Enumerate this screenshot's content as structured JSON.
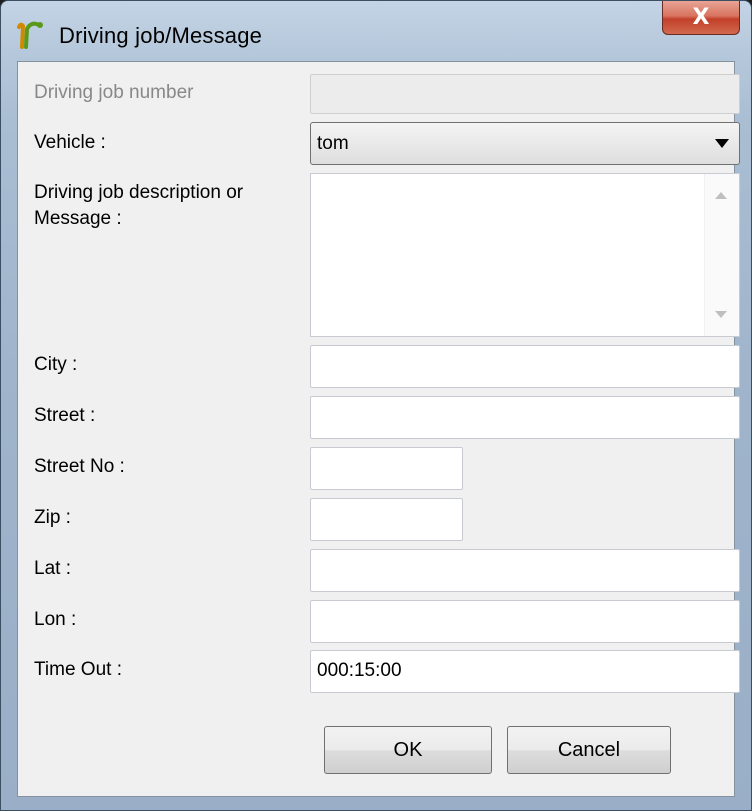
{
  "window": {
    "title": "Driving job/Message",
    "icon": "app-logo-icon",
    "close_label": "X"
  },
  "form": {
    "job_number": {
      "label": "Driving job number",
      "value": ""
    },
    "vehicle": {
      "label": "Vehicle :",
      "value": "tom"
    },
    "description": {
      "label_line1": "Driving job description or",
      "label_line2": "Message :",
      "value": ""
    },
    "city": {
      "label": "City :",
      "value": ""
    },
    "street": {
      "label": "Street :",
      "value": ""
    },
    "street_no": {
      "label": "Street No :",
      "value": ""
    },
    "zip": {
      "label": "Zip :",
      "value": ""
    },
    "lat": {
      "label": "Lat :",
      "value": ""
    },
    "lon": {
      "label": "Lon :",
      "value": ""
    },
    "timeout": {
      "label": "Time Out :",
      "value": "000:15:00"
    }
  },
  "buttons": {
    "ok": "OK",
    "cancel": "Cancel"
  },
  "colors": {
    "close_button": "#c8452f",
    "client_bg": "#f0f0f0",
    "frame": "#b3c6db"
  }
}
